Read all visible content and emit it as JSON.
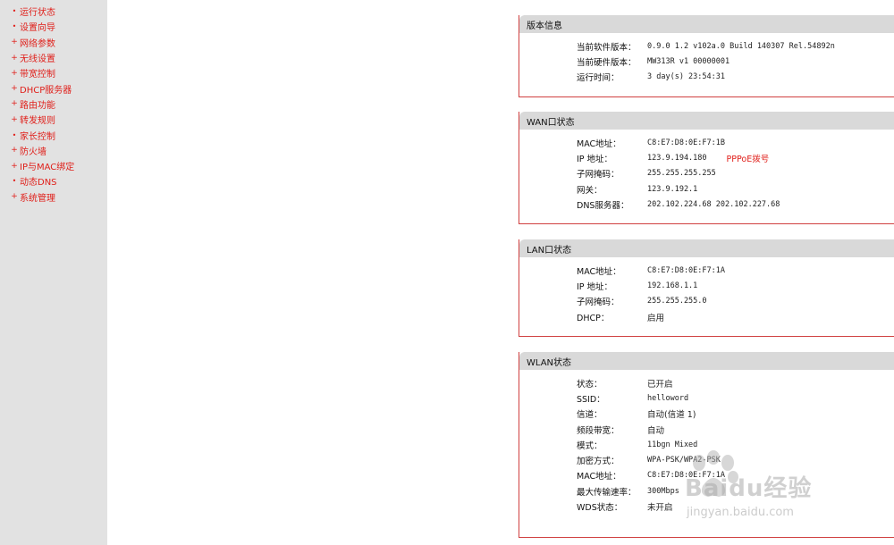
{
  "sidebar": {
    "items": [
      {
        "label": "运行状态",
        "bullet": "•"
      },
      {
        "label": "设置向导",
        "bullet": "•"
      },
      {
        "label": "网络参数",
        "bullet": "+"
      },
      {
        "label": "无线设置",
        "bullet": "+"
      },
      {
        "label": "带宽控制",
        "bullet": "+"
      },
      {
        "label": "DHCP服务器",
        "bullet": "+"
      },
      {
        "label": "路由功能",
        "bullet": "+"
      },
      {
        "label": "转发规则",
        "bullet": "+"
      },
      {
        "label": "家长控制",
        "bullet": "•"
      },
      {
        "label": "防火墙",
        "bullet": "+"
      },
      {
        "label": "IP与MAC绑定",
        "bullet": "+"
      },
      {
        "label": "动态DNS",
        "bullet": "•"
      },
      {
        "label": "系统管理",
        "bullet": "+"
      }
    ]
  },
  "version": {
    "title": "版本信息",
    "rows": [
      {
        "label": "当前软件版本：",
        "value": "0.9.0 1.2 v102a.0 Build 140307 Rel.54892n"
      },
      {
        "label": "当前硬件版本：",
        "value": "MW313R v1 00000001"
      },
      {
        "label": "运行时间：",
        "value": "3 day(s) 23:54:31"
      }
    ]
  },
  "wan": {
    "title": "WAN口状态",
    "rows": [
      {
        "label": "MAC地址：",
        "value": "C8:E7:D8:0E:F7:1B"
      },
      {
        "label": "IP 地址：",
        "value": "123.9.194.180",
        "extra": "PPPoE拨号"
      },
      {
        "label": "子网掩码：",
        "value": "255.255.255.255"
      },
      {
        "label": "网关：",
        "value": "123.9.192.1"
      },
      {
        "label": "DNS服务器：",
        "value": "202.102.224.68 202.102.227.68"
      }
    ]
  },
  "lan": {
    "title": "LAN口状态",
    "rows": [
      {
        "label": "MAC地址：",
        "value": "C8:E7:D8:0E:F7:1A"
      },
      {
        "label": "IP 地址：",
        "value": "192.168.1.1"
      },
      {
        "label": "子网掩码：",
        "value": "255.255.255.0"
      },
      {
        "label": "DHCP：",
        "value": "启用"
      }
    ]
  },
  "wlan": {
    "title": "WLAN状态",
    "rows": [
      {
        "label": "状态：",
        "value": "已开启"
      },
      {
        "label": "SSID：",
        "value": "helloword"
      },
      {
        "label": "信道：",
        "value": "自动(信道 1)"
      },
      {
        "label": "频段带宽：",
        "value": "自动"
      },
      {
        "label": "模式：",
        "value": "11bgn Mixed"
      },
      {
        "label": "加密方式：",
        "value": "WPA-PSK/WPA2-PSK"
      },
      {
        "label": "MAC地址：",
        "value": "C8:E7:D8:0E:F7:1A"
      },
      {
        "label": "最大传输速率：",
        "value": "300Mbps"
      },
      {
        "label": "WDS状态：",
        "value": "未开启"
      }
    ]
  },
  "watermark": {
    "text": "Baidu经验",
    "url": "jingyan.baidu.com"
  },
  "colors": {
    "accent": "#e0201b",
    "sidebar_bg": "#e2e2e2",
    "panel_head_bg": "#d9d9d9",
    "panel_border": "#d04040"
  }
}
